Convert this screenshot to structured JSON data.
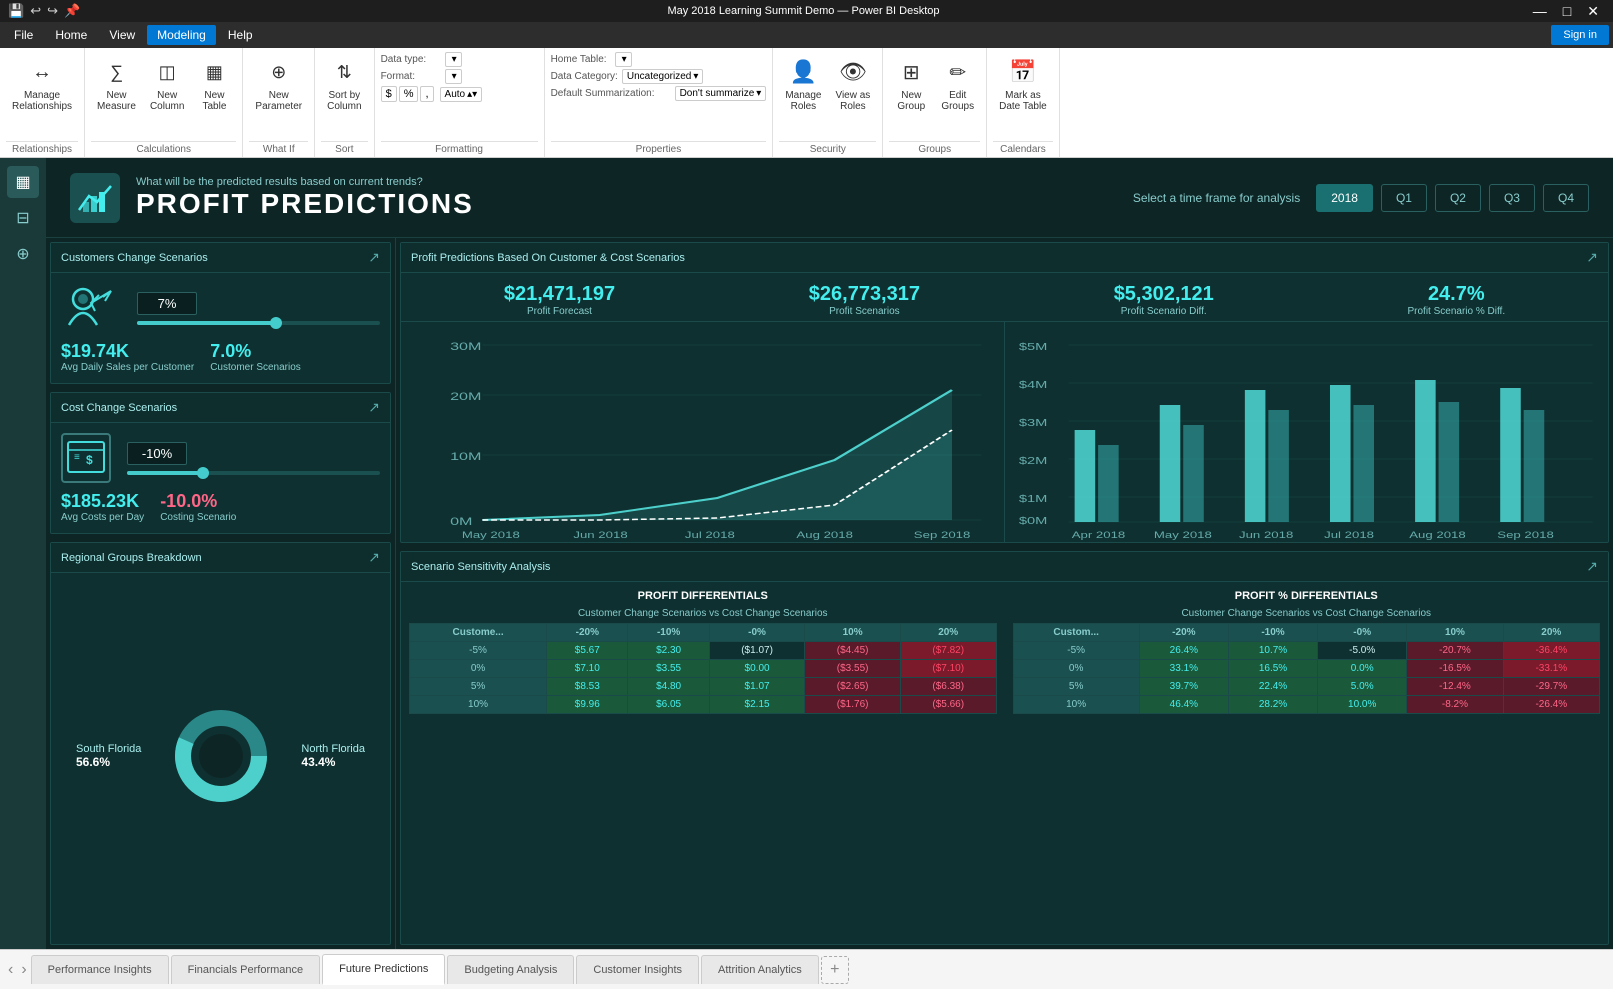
{
  "titlebar": {
    "title": "May 2018 Learning Summit Demo — Power BI Desktop",
    "controls": [
      "—",
      "□",
      "✕"
    ]
  },
  "quickaccess": {
    "title": "May 2018 Learning Summit Demo — Power BI Desktop"
  },
  "menu": {
    "items": [
      "File",
      "Home",
      "View",
      "Modeling",
      "Help"
    ],
    "active": "Modeling"
  },
  "ribbon": {
    "groups": [
      {
        "label": "Relationships",
        "items": [
          {
            "icon": "↔",
            "label": "Manage\nRelationships"
          }
        ]
      },
      {
        "label": "Calculations",
        "items": [
          {
            "icon": "∑",
            "label": "New\nMeasure"
          },
          {
            "icon": "◫",
            "label": "New\nColumn"
          },
          {
            "icon": "◱",
            "label": "New\nTable"
          }
        ]
      },
      {
        "label": "What If",
        "items": [
          {
            "icon": "⊕",
            "label": "New\nParameter"
          }
        ]
      },
      {
        "label": "Sort",
        "items": [
          {
            "icon": "⇅",
            "label": "Sort by\nColumn"
          }
        ]
      },
      {
        "label": "Formatting",
        "datatype_label": "Data type:",
        "datatype_val": "",
        "format_label": "Format:",
        "format_val": "",
        "currency_symbols": [
          "$",
          "%"
        ],
        "auto_label": "Auto"
      },
      {
        "label": "Properties",
        "home_table_label": "Home Table:",
        "home_table_val": "",
        "data_cat_label": "Data Category:",
        "data_cat_val": "Uncategorized",
        "default_sum_label": "Default Summarization:",
        "default_sum_val": "Don't summarize"
      },
      {
        "label": "Security",
        "items": [
          {
            "icon": "👤",
            "label": "Manage\nRoles"
          },
          {
            "icon": "👁",
            "label": "View as\nRoles"
          }
        ]
      },
      {
        "label": "Groups",
        "items": [
          {
            "icon": "⊞",
            "label": "New\nGroup"
          },
          {
            "icon": "✏",
            "label": "Edit\nGroups"
          }
        ]
      },
      {
        "label": "Calendars",
        "items": [
          {
            "icon": "📅",
            "label": "Mark as\nDate Table"
          }
        ]
      }
    ]
  },
  "sidebar": {
    "icons": [
      {
        "name": "report-view-icon",
        "symbol": "▦",
        "active": false
      },
      {
        "name": "data-view-icon",
        "symbol": "⊟",
        "active": false
      },
      {
        "name": "model-view-icon",
        "symbol": "⊕",
        "active": false
      }
    ]
  },
  "dashboard": {
    "header": {
      "subtitle": "What will be the predicted results based on current trends?",
      "title": "PROFIT PREDICTIONS",
      "time_label": "Select a time frame for analysis",
      "time_buttons": [
        "2018",
        "Q1",
        "Q2",
        "Q3",
        "Q4"
      ],
      "active_time": "2018"
    },
    "customers_panel": {
      "title": "Customers Change Scenarios",
      "slider_value": "7%",
      "avg_daily_sales": "$19.74K",
      "avg_daily_sales_label": "Avg Daily Sales per Customer",
      "customer_scenarios": "7.0%",
      "customer_scenarios_label": "Customer Scenarios"
    },
    "cost_panel": {
      "title": "Cost Change Scenarios",
      "slider_value": "-10%",
      "avg_costs": "$185.23K",
      "avg_costs_label": "Avg Costs per Day",
      "costing_scenario": "-10.0%",
      "costing_scenario_label": "Costing Scenario"
    },
    "regional_panel": {
      "title": "Regional Groups Breakdown",
      "segments": [
        {
          "name": "South Florida",
          "pct": "56.6%",
          "color": "#4dd0cc"
        },
        {
          "name": "North Florida",
          "pct": "43.4%",
          "color": "#2a8888"
        }
      ]
    },
    "profit_panel": {
      "title": "Profit Predictions Based On Customer & Cost Scenarios",
      "metrics": [
        {
          "value": "$21,471,197",
          "label": "Profit Forecast"
        },
        {
          "value": "$26,773,317",
          "label": "Profit Scenarios"
        },
        {
          "value": "$5,302,121",
          "label": "Profit Scenario Diff."
        },
        {
          "value": "24.7%",
          "label": "Profit Scenario % Diff."
        }
      ],
      "line_chart": {
        "y_labels": [
          "30M",
          "20M",
          "10M",
          "0M"
        ],
        "x_labels": [
          "May 2018",
          "Jun 2018",
          "Jul 2018",
          "Aug 2018",
          "Sep 2018"
        ]
      },
      "bar_chart": {
        "y_labels": [
          "$5M",
          "$4M",
          "$3M",
          "$2M",
          "$1M",
          "$0M"
        ],
        "x_labels": [
          "Apr 2018",
          "May 2018",
          "Jun 2018",
          "Jul 2018",
          "Aug 2018",
          "Sep 2018"
        ]
      }
    },
    "sensitivity_panel": {
      "title": "Scenario Sensitivity Analysis",
      "profit_diff": {
        "title": "PROFIT DIFFERENTIALS",
        "subtitle": "Customer Change Scenarios vs Cost Change Scenarios",
        "headers": [
          "Custome...",
          "-20%",
          "-10%",
          "-0%",
          "10%",
          "20%"
        ],
        "rows": [
          [
            "-5%",
            "$5.67",
            "$2.30",
            "($1.07)",
            "($4.45)",
            "($7.82)"
          ],
          [
            "0%",
            "$7.10",
            "$3.55",
            "$0.00",
            "($3.55)",
            "($7.10)"
          ],
          [
            "5%",
            "$8.53",
            "$4.80",
            "$1.07",
            "($2.65)",
            "($6.38)"
          ],
          [
            "10%",
            "$9.96",
            "$6.05",
            "$2.15",
            "($1.76)",
            "($5.66)"
          ]
        ],
        "positive_cells": [
          [
            0,
            1
          ],
          [
            0,
            2
          ],
          [
            1,
            1
          ],
          [
            1,
            2
          ],
          [
            1,
            3
          ],
          [
            2,
            1
          ],
          [
            2,
            2
          ],
          [
            2,
            3
          ],
          [
            3,
            1
          ],
          [
            3,
            2
          ],
          [
            3,
            3
          ],
          [
            3,
            4
          ]
        ],
        "negative_cells": [
          [
            0,
            3
          ],
          [
            0,
            4
          ],
          [
            0,
            5
          ],
          [
            1,
            4
          ],
          [
            1,
            5
          ],
          [
            2,
            4
          ],
          [
            2,
            5
          ],
          [
            3,
            5
          ]
        ]
      },
      "profit_pct_diff": {
        "title": "PROFIT % DIFFERENTIALS",
        "subtitle": "Customer Change Scenarios vs Cost Change Scenarios",
        "headers": [
          "Custom...",
          "-20%",
          "-10%",
          "-0%",
          "10%",
          "20%"
        ],
        "rows": [
          [
            "-5%",
            "26.4%",
            "10.7%",
            "-5.0%",
            "-20.7%",
            "-36.4%"
          ],
          [
            "0%",
            "33.1%",
            "16.5%",
            "0.0%",
            "-16.5%",
            "-33.1%"
          ],
          [
            "5%",
            "39.7%",
            "22.4%",
            "5.0%",
            "-12.4%",
            "-29.7%"
          ],
          [
            "10%",
            "46.4%",
            "28.2%",
            "10.0%",
            "-8.2%",
            "-26.4%"
          ]
        ]
      }
    }
  },
  "tabs": {
    "items": [
      "Performance Insights",
      "Financials Performance",
      "Future Predictions",
      "Budgeting Analysis",
      "Customer Insights",
      "Attrition Analytics"
    ],
    "active": "Future Predictions"
  },
  "signin": {
    "label": "Sign in"
  }
}
